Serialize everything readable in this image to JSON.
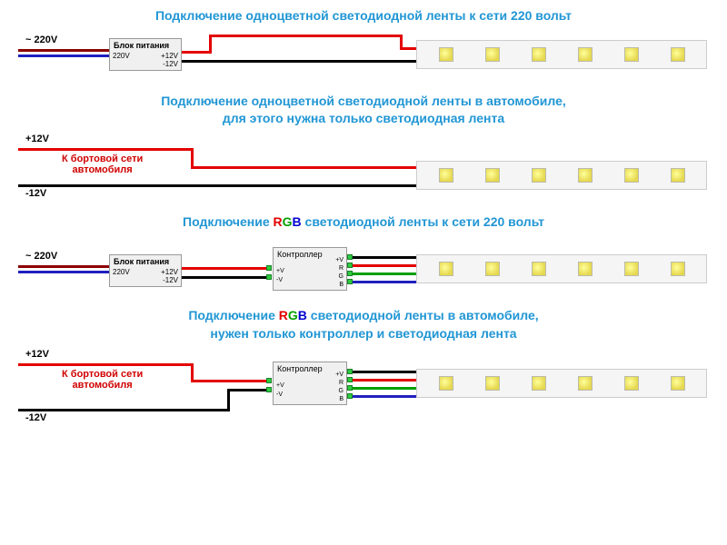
{
  "titles": {
    "t1": "Подключение одноцветной светодиодной ленты к сети 220 вольт",
    "t2a": "Подключение одноцветной светодиодной ленты в автомобиле,",
    "t2b": "для этого нужна только светодиодная лента",
    "t3_prefix": "Подключение ",
    "t3_suffix": " светодиодной ленты к сети 220 вольт",
    "t4a_prefix": "Подключение ",
    "t4a_suffix": " светодиодной ленты в автомобиле,",
    "t4b": "нужен только контроллер и светодиодная лента",
    "rgb_r": "R",
    "rgb_g": "G",
    "rgb_b": "B"
  },
  "labels": {
    "v220": "~ 220V",
    "plus12": "+12V",
    "minus12": "-12V",
    "psu_title": "Блок питания",
    "psu_in": "220V",
    "psu_out1": "+12V",
    "psu_out2": "-12V",
    "car_net": "К бортовой сети",
    "car_net2": "автомобиля",
    "ctrl_title": "Контроллер",
    "ctrl_in1": "+V",
    "ctrl_in2": "-V",
    "ctrl_o_v": "+V",
    "ctrl_o_r": "R",
    "ctrl_o_g": "G",
    "ctrl_o_b": "B"
  },
  "colors": {
    "red": "#e30000",
    "black": "#000",
    "blue": "#2020c0",
    "darkred": "#8b0000",
    "green": "#00a000"
  }
}
